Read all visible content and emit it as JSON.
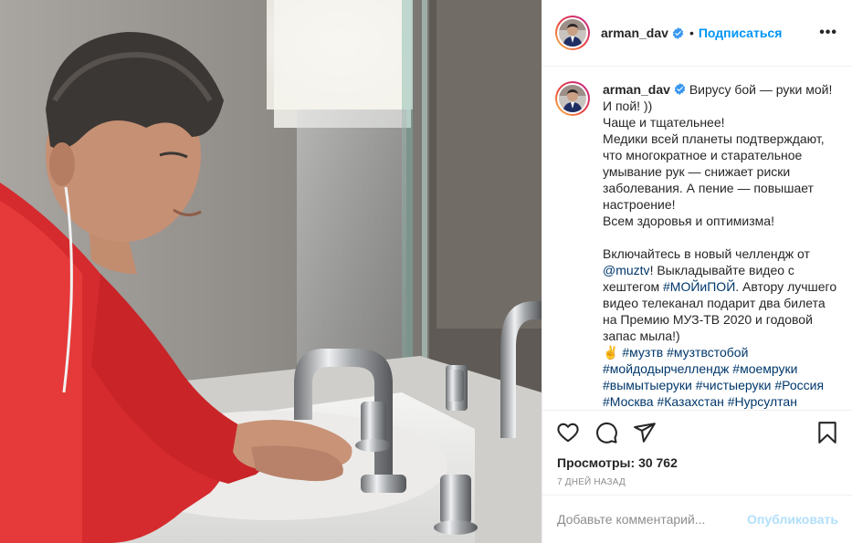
{
  "post": {
    "username": "arman_dav",
    "verified": true,
    "follow_label": "Подписаться",
    "more_icon": "more-options-icon",
    "avatar_icon": "profile-avatar"
  },
  "media": {
    "type": "video",
    "description_icon": "video-frame"
  },
  "caption": {
    "username": "arman_dav",
    "line1": " Вирусу бой — руки мой! И пой! ))",
    "para1": "Чаще и тщательнее!\nМедики всей планеты подтверждают, что многократное и старательное умывание рук — снижает риски заболевания. А пение — повышает настроение!\nВсем здоровья и оптимизма!",
    "para2_pre": "Включайтесь в новый челлендж от ",
    "mention": "@muztv",
    "para2_mid": "! Выкладывайте видео с хештегом ",
    "hashtag_main": "#МОЙиПОЙ",
    "para2_post": ". Автору лучшего видео телеканал подарит два билета на Премию МУЗ-ТВ 2020 и годовой запас мыла!)",
    "emoji": "✌️",
    "hashtags": [
      "#музтв",
      "#музтвстобой",
      "#мойдодырчеллендж",
      "#моемруки",
      "#вымытыеруки",
      "#чистыеруки",
      "#Россия",
      "#Москва",
      "#Казахстан",
      "#Нурсултан"
    ]
  },
  "actions": {
    "like_icon": "heart-icon",
    "comment_icon": "comment-icon",
    "share_icon": "share-icon",
    "save_icon": "bookmark-icon"
  },
  "stats": {
    "views_label": "Просмотры:",
    "views_count": "30 762",
    "date": "7 ДНЕЙ НАЗАД"
  },
  "comment": {
    "placeholder": "Добавьте комментарий...",
    "publish_label": "Опубликовать"
  },
  "colors": {
    "accent": "#0095f6",
    "link": "#00376b",
    "muted": "#8e8e8e",
    "publish_disabled": "#b2dffc"
  }
}
